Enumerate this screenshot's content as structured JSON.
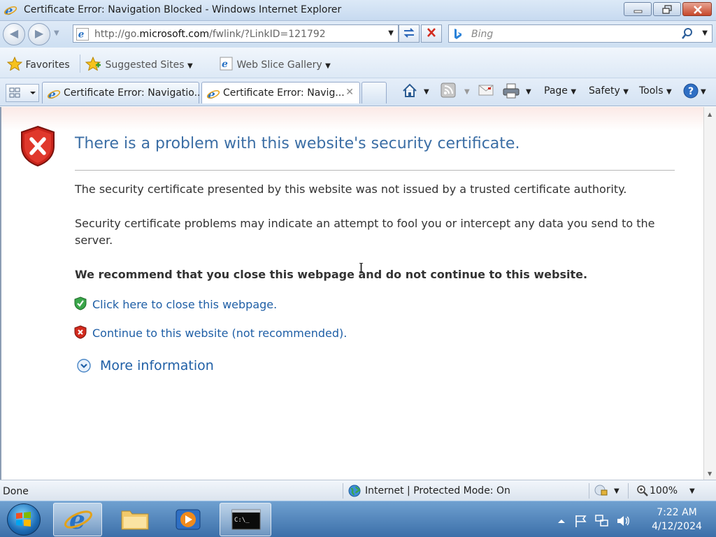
{
  "window": {
    "title": "Certificate Error: Navigation Blocked - Windows Internet Explorer"
  },
  "address": {
    "url_prefix": "http://go.",
    "url_domain": "microsoft.com",
    "url_suffix": "/fwlink/?LinkID=121792"
  },
  "search": {
    "placeholder": "Bing"
  },
  "favorites": {
    "favorites_label": "Favorites",
    "suggested_sites": "Suggested Sites",
    "web_slice_gallery": "Web Slice Gallery"
  },
  "tabs": [
    {
      "label": "Certificate Error: Navigatio..."
    },
    {
      "label": "Certificate Error: Navig..."
    }
  ],
  "command_bar": {
    "page": "Page",
    "safety": "Safety",
    "tools": "Tools"
  },
  "page": {
    "heading": "There is a problem with this website's security certificate.",
    "para1": "The security certificate presented by this website was not issued by a trusted certificate authority.",
    "para2": "Security certificate problems may indicate an attempt to fool you or intercept any data you send to the server.",
    "recommend": "We recommend that you close this webpage and do not continue to this website.",
    "close_link": "Click here to close this webpage.",
    "continue_link": "Continue to this website (not recommended).",
    "more_info": "More information"
  },
  "status": {
    "left": "Done",
    "zone": "Internet | Protected Mode: On",
    "zoom": "100%"
  },
  "taskbar": {
    "time": "7:22 AM",
    "date": "4/12/2024"
  },
  "colors": {
    "link": "#1f5fa6",
    "heading": "#3b6ea5"
  }
}
